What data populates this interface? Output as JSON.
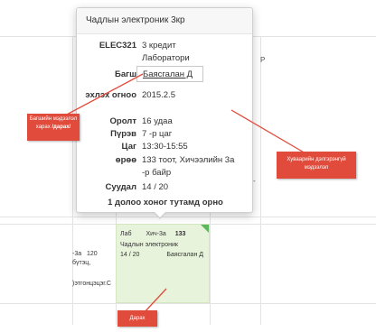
{
  "popover": {
    "title": "Чадлын электроник 3кр",
    "code": "ELEC321",
    "credit": "3 кредит",
    "type": "Лаборатори",
    "teacher_label": "Багш",
    "teacher_name": "Баясгалан Д",
    "start_label": "эхлэх огноо",
    "start_value": "2015.2.5",
    "count_label": "Оролт",
    "count_value": "16 удаа",
    "period_label": "Пүрэв",
    "period_value": "7 -р цаг",
    "time_label": "Цаг",
    "time_value": "13:30-15:55",
    "room_label": "өрөө",
    "room_value_1": "133 тоот, Хичээлийн 3а",
    "room_value_2": "-р байр",
    "seats_label": "Суудал",
    "seats_value": "14 / 20",
    "frequency": "1 долоо хоног тутамд орно"
  },
  "schedule_cell": {
    "type": "Лаб",
    "building": "Хич-3а",
    "room": "133",
    "name": "Чадлын электроник",
    "seats": "14 / 20",
    "teacher": "Баясгалан Д"
  },
  "neighbor_cell": {
    "building": "-3а",
    "room": "120",
    "name_fragment": "бүтэц,",
    "teacher_fragment": ")этгонцэцэг.С"
  },
  "edge_text": {
    "left_p": "P",
    "left_dash": "-"
  },
  "callouts": {
    "teacher_info_1": "Багшийн мэдээлэл",
    "teacher_info_2": "харах",
    "teacher_info_3": "/дарах/",
    "schedule_info_1": "Хуваарийн дэлгэрэнгүй",
    "schedule_info_2": "мэдээлэл",
    "press": "Дарах"
  },
  "colors": {
    "callout_bg": "#e14b3b",
    "cell_bg": "#e8f3dc",
    "accent_green": "#5cb85c"
  }
}
